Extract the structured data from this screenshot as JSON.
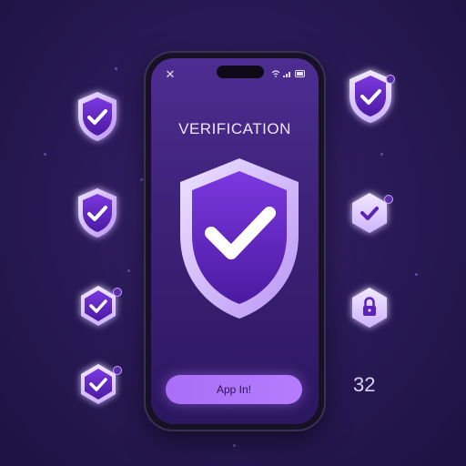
{
  "screen": {
    "title": "VERIFICATION",
    "cta_label": "App In!"
  },
  "counter": "32",
  "icons": {
    "close": "close-icon",
    "hero": "shield-check-icon",
    "left_1": "shield-check-icon",
    "left_2": "shield-check-icon",
    "left_3": "hexagon-check-icon",
    "left_4": "hexagon-check-icon",
    "right_1": "shield-check-icon",
    "right_2": "hexagon-check-icon",
    "right_3": "hexagon-lock-icon"
  },
  "colors": {
    "background": "#2a1a58",
    "shield_fill": "#5a24b8",
    "shield_border": "#d6c2ff",
    "button": "#b07cff",
    "check": "#ffffff"
  }
}
